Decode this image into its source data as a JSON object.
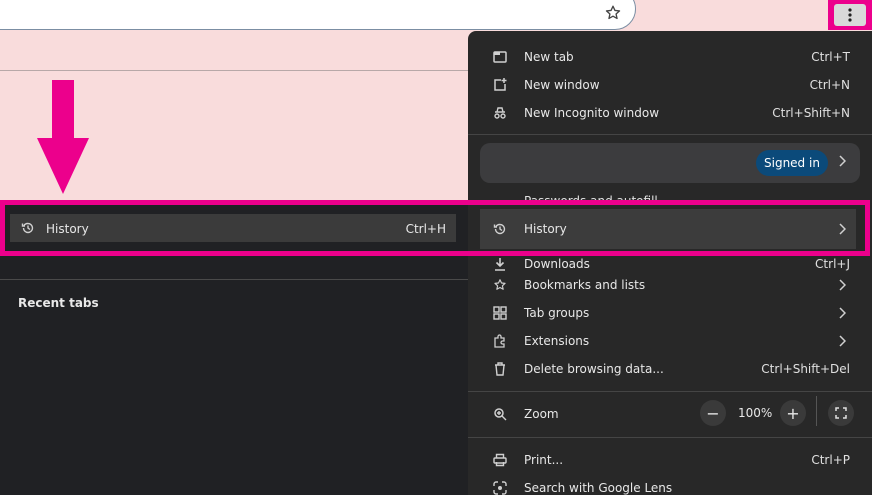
{
  "menu": {
    "items": [
      {
        "label": "New tab",
        "shortcut": "Ctrl+T",
        "icon": "new-tab-icon"
      },
      {
        "label": "New window",
        "shortcut": "Ctrl+N",
        "icon": "new-window-icon"
      },
      {
        "label": "New Incognito window",
        "shortcut": "Ctrl+Shift+N",
        "icon": "incognito-icon"
      }
    ],
    "profile": {
      "badge": "Signed in"
    },
    "passwords_partial": "Passwords and autofill",
    "history": {
      "label": "History",
      "icon": "history-icon"
    },
    "downloads": {
      "label": "Downloads",
      "shortcut": "Ctrl+J",
      "icon": "download-icon"
    },
    "lower_items": [
      {
        "label": "Bookmarks and lists",
        "icon": "star-icon"
      },
      {
        "label": "Tab groups",
        "icon": "tab-groups-icon"
      },
      {
        "label": "Extensions",
        "icon": "extension-icon"
      },
      {
        "label": "Delete browsing data...",
        "shortcut": "Ctrl+Shift+Del",
        "icon": "trash-icon"
      }
    ],
    "zoom": {
      "label": "Zoom",
      "value": "100%",
      "minus": "−",
      "plus": "+"
    },
    "print": {
      "label": "Print...",
      "shortcut": "Ctrl+P"
    },
    "lens": {
      "label": "Search with Google Lens"
    }
  },
  "submenu": {
    "history": {
      "label": "History",
      "shortcut": "Ctrl+H"
    },
    "recent_tabs": "Recent tabs"
  },
  "colors": {
    "highlight": "#ec008c",
    "menu_bg": "#282828",
    "page_bg": "#f9dcdc"
  }
}
